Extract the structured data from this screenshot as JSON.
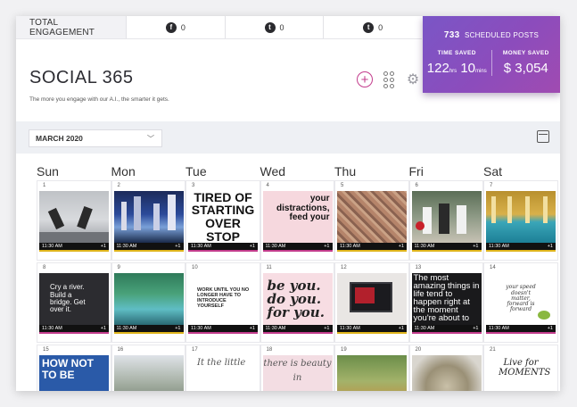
{
  "engagement": {
    "label": "TOTAL ENGAGEMENT",
    "stats": [
      {
        "icon": "facebook-icon",
        "glyph": "f",
        "value": "0"
      },
      {
        "icon": "twitter-icon",
        "glyph": "t",
        "value": "0"
      },
      {
        "icon": "tumblr-icon",
        "glyph": "t",
        "value": "0"
      }
    ]
  },
  "brand": {
    "name": "SOCIAL 365",
    "tagline": "The more you engage with our A.I., the smarter it gets."
  },
  "scheduled": {
    "count": "733",
    "label": "SCHEDULED POSTS",
    "time_label": "TIME SAVED",
    "hrs": "122",
    "hrs_unit": "hrs",
    "mins": "10",
    "mins_unit": "mins",
    "money_label": "MONEY SAVED",
    "money": "$ 3,054"
  },
  "month": {
    "selected": "MARCH 2020"
  },
  "days": [
    "Sun",
    "Mon",
    "Tue",
    "Wed",
    "Thu",
    "Fri",
    "Sat"
  ],
  "colors": {
    "accent": "#c33c8c",
    "panel": "#8c4cbc"
  },
  "posts": {
    "tired": "TIRED OF STARTING OVER STOP",
    "distractions": "your distractions, feed your",
    "cry": "Cry a river. Build a bridge. Get over it.",
    "work": "WORK UNTIL YOU NO LONGER HAVE TO INTRODUCE YOURSELF",
    "beyou": "be you. do you. for you.",
    "amazing": "The most amazing things in life tend to happen right at the moment you're about to",
    "yoursoul": "your speed doesn't matter, forward is forward",
    "hownot": "HOW NOT TO BE",
    "thelittle": "It the little",
    "thereis": "there is beauty in",
    "livefor": "Live for MOMENTS"
  },
  "weeks": [
    [
      {
        "day": "1",
        "time": "11:30 AM",
        "plus": "+1"
      },
      {
        "day": "2",
        "time": "11:30 AM",
        "plus": "+1"
      },
      {
        "day": "3",
        "time": "11:30 AM",
        "plus": "+1"
      },
      {
        "day": "4",
        "time": "11:30 AM",
        "plus": "+1"
      },
      {
        "day": "5",
        "time": "11:30 AM",
        "plus": "+1"
      },
      {
        "day": "6",
        "time": "11:30 AM",
        "plus": "+1"
      },
      {
        "day": "7",
        "time": "11:30 AM",
        "plus": "+1"
      }
    ],
    [
      {
        "day": "8",
        "time": "11:30 AM",
        "plus": "+1"
      },
      {
        "day": "9",
        "time": "11:30 AM",
        "plus": "+1"
      },
      {
        "day": "10",
        "time": "11:30 AM",
        "plus": "+1"
      },
      {
        "day": "11",
        "time": "11:30 AM",
        "plus": "+1"
      },
      {
        "day": "12",
        "time": "11:30 AM",
        "plus": "+1"
      },
      {
        "day": "13",
        "time": "11:30 AM",
        "plus": "+1"
      },
      {
        "day": "14",
        "time": "11:30 AM",
        "plus": "+1"
      }
    ],
    [
      {
        "day": "15"
      },
      {
        "day": "16"
      },
      {
        "day": "17"
      },
      {
        "day": "18"
      },
      {
        "day": "19"
      },
      {
        "day": "20"
      },
      {
        "day": "21"
      }
    ]
  ]
}
